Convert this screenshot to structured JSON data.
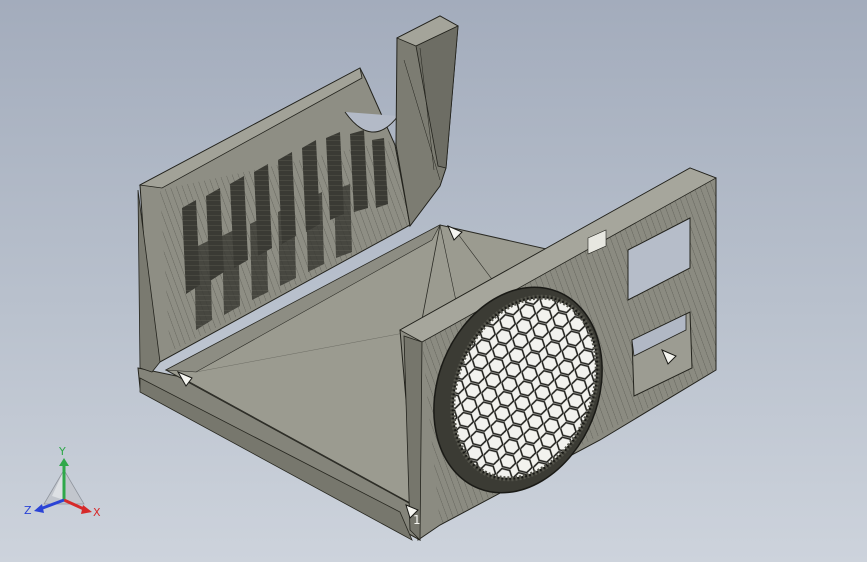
{
  "viewport": {
    "background_top": "#a3acbc",
    "background_bottom": "#cdd3dc"
  },
  "model": {
    "shape": "printer-enclosure-tray",
    "body_color": "#8f8f84",
    "floor_color": "#9a9a8f",
    "edge_color": "#262620",
    "fan_grille": "hexagon-mesh",
    "corner_marker": "1"
  },
  "triad": {
    "x_label": "X",
    "y_label": "Y",
    "z_label": "Z",
    "x_color": "#d62a2a",
    "y_color": "#2fa84a",
    "z_color": "#2a43d6"
  }
}
